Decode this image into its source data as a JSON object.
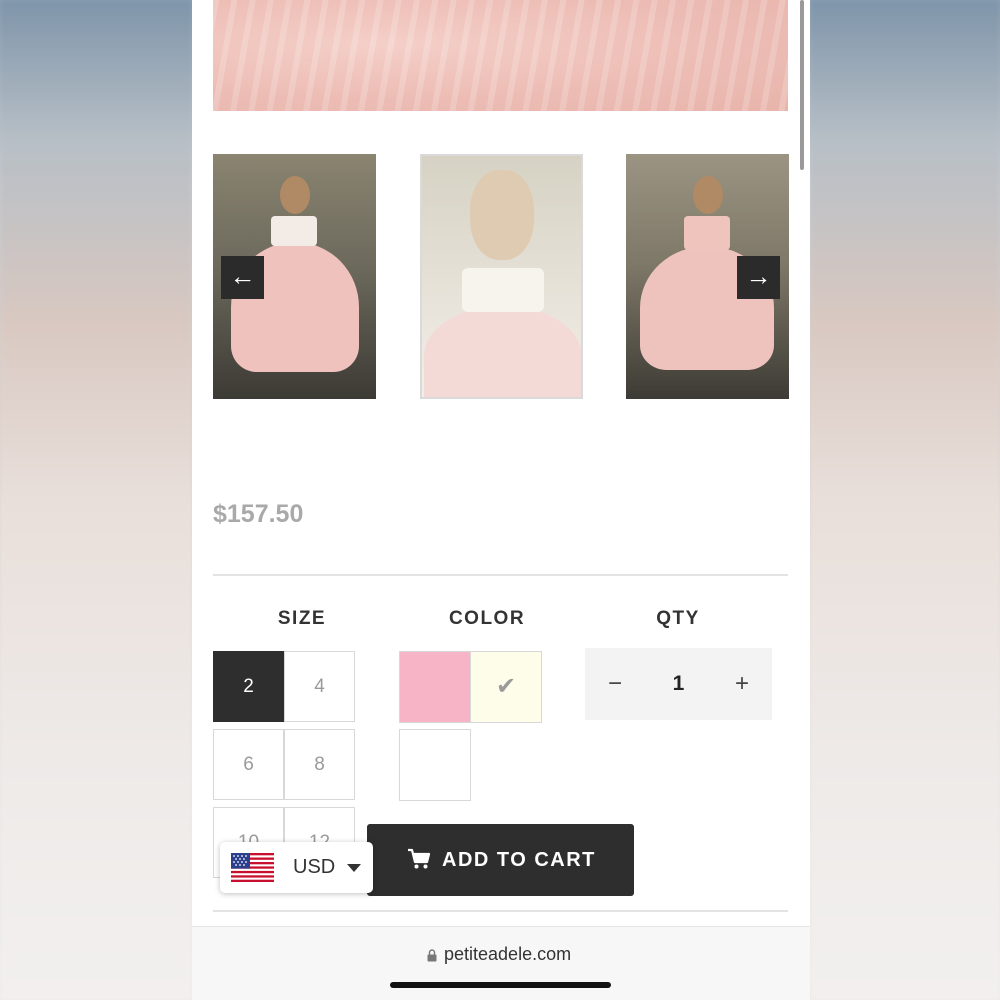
{
  "gallery": {
    "prev_icon": "arrow-left-icon",
    "next_icon": "arrow-right-icon",
    "prev_glyph": "←",
    "next_glyph": "→"
  },
  "product": {
    "price": "$157.50"
  },
  "options": {
    "size_label": "SIZE",
    "color_label": "COLOR",
    "qty_label": "QTY",
    "sizes": [
      "2",
      "4",
      "6",
      "8",
      "10",
      "12"
    ],
    "selected_size": "2",
    "colors": [
      {
        "name": "pink",
        "hex": "#f7b4c7"
      },
      {
        "name": "ivory",
        "hex": "#fefde9",
        "selected": true
      },
      {
        "name": "white",
        "hex": "#ffffff"
      }
    ],
    "check_glyph": "✔"
  },
  "qty": {
    "value": "1",
    "minus": "−",
    "plus": "+"
  },
  "cart": {
    "add_label": "ADD TO CART",
    "icon": "cart-icon"
  },
  "currency": {
    "code": "USD",
    "flag": "us-flag-icon"
  },
  "browser": {
    "url": "petiteadele.com",
    "icon": "lock-icon"
  },
  "colors": {
    "button_dark": "#2e2e2e",
    "price_gray": "#a9a9a9"
  }
}
